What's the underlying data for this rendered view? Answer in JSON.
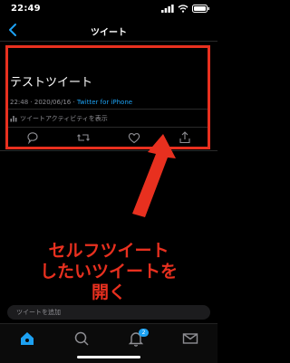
{
  "status": {
    "time": "22:49",
    "signal_icon": "signal-bars-icon",
    "wifi_icon": "wifi-icon",
    "battery_icon": "battery-icon"
  },
  "nav": {
    "title": "ツイート",
    "back_icon": "back-chevron-icon"
  },
  "tweet": {
    "text": "テストツイート",
    "time": "22:48",
    "date": "2020/06/16",
    "via": "Twitter for iPhone",
    "activity_label": "ツイートアクティビティを表示",
    "actions": [
      "reply-icon",
      "retweet-icon",
      "like-icon",
      "share-icon"
    ]
  },
  "annotation": {
    "caption_lines": [
      "セルフツイート",
      "したいツイートを",
      "開く"
    ],
    "color": "#e8301f"
  },
  "compose": {
    "placeholder": "ツイートを追加"
  },
  "tabbar": {
    "tabs": [
      "home-icon",
      "search-icon",
      "notifications-icon",
      "messages-icon"
    ],
    "notification_count": "2",
    "accent": "#1da1f2"
  }
}
